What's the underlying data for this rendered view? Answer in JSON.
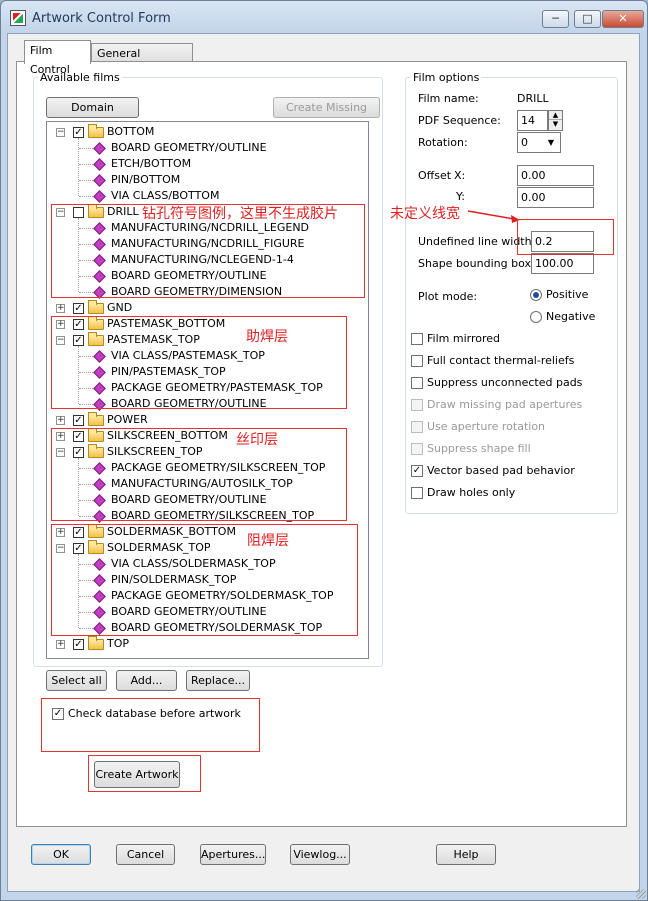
{
  "window": {
    "title": "Artwork Control Form",
    "controls": {
      "minimize": "─",
      "maximize": "□",
      "close": "✕"
    }
  },
  "tabs": [
    {
      "label": "Film Control",
      "active": true
    },
    {
      "label": "General Parameters",
      "active": false
    }
  ],
  "available_films": {
    "group_label": "Available films",
    "domain_selection": "Domain Selection",
    "create_missing_films": "Create Missing Films",
    "tree": [
      {
        "name": "BOTTOM",
        "checked": true,
        "expanded": true,
        "children": [
          "BOARD GEOMETRY/OUTLINE",
          "ETCH/BOTTOM",
          "PIN/BOTTOM",
          "VIA CLASS/BOTTOM"
        ]
      },
      {
        "name": "DRILL",
        "checked": false,
        "expanded": true,
        "children": [
          "MANUFACTURING/NCDRILL_LEGEND",
          "MANUFACTURING/NCDRILL_FIGURE",
          "MANUFACTURING/NCLEGEND-1-4",
          "BOARD GEOMETRY/OUTLINE",
          "BOARD GEOMETRY/DIMENSION"
        ]
      },
      {
        "name": "GND",
        "checked": true,
        "expanded": false,
        "children": []
      },
      {
        "name": "PASTEMASK_BOTTOM",
        "checked": true,
        "expanded": false,
        "children": []
      },
      {
        "name": "PASTEMASK_TOP",
        "checked": true,
        "expanded": true,
        "children": [
          "VIA CLASS/PASTEMASK_TOP",
          "PIN/PASTEMASK_TOP",
          "PACKAGE GEOMETRY/PASTEMASK_TOP",
          "BOARD GEOMETRY/OUTLINE"
        ]
      },
      {
        "name": "POWER",
        "checked": true,
        "expanded": false,
        "children": []
      },
      {
        "name": "SILKSCREEN_BOTTOM",
        "checked": true,
        "expanded": false,
        "children": []
      },
      {
        "name": "SILKSCREEN_TOP",
        "checked": true,
        "expanded": true,
        "children": [
          "PACKAGE GEOMETRY/SILKSCREEN_TOP",
          "MANUFACTURING/AUTOSILK_TOP",
          "BOARD GEOMETRY/OUTLINE",
          "BOARD GEOMETRY/SILKSCREEN_TOP"
        ]
      },
      {
        "name": "SOLDERMASK_BOTTOM",
        "checked": true,
        "expanded": false,
        "children": []
      },
      {
        "name": "SOLDERMASK_TOP",
        "checked": true,
        "expanded": true,
        "children": [
          "VIA CLASS/SOLDERMASK_TOP",
          "PIN/SOLDERMASK_TOP",
          "PACKAGE GEOMETRY/SOLDERMASK_TOP",
          "BOARD GEOMETRY/OUTLINE",
          "BOARD GEOMETRY/SOLDERMASK_TOP"
        ]
      },
      {
        "name": "TOP",
        "checked": true,
        "expanded": false,
        "children": []
      }
    ],
    "select_all": "Select all",
    "add": "Add...",
    "replace": "Replace...",
    "check_database": {
      "label": "Check database before artwork",
      "checked": true
    },
    "create_artwork": "Create Artwork"
  },
  "annotations": {
    "drill_note": "钻孔符号图例，这里不生成胶片",
    "line_width_note": "未定义线宽",
    "pastemask_note": "助焊层",
    "silkscreen_note": "丝印层",
    "soldermask_note": "阻焊层",
    "color": "#e02020"
  },
  "film_options": {
    "group_label": "Film options",
    "film_name_label": "Film name:",
    "film_name_value": "DRILL",
    "pdf_sequence_label": "PDF Sequence:",
    "pdf_sequence_value": "14",
    "rotation_label": "Rotation:",
    "rotation_value": "0",
    "offset_label": "Offset",
    "offset_x_label": "X:",
    "offset_x_value": "0.00",
    "offset_y_label": "Y:",
    "offset_y_value": "0.00",
    "undefined_line_width_label": "Undefined line width:",
    "undefined_line_width_value": "0.2",
    "shape_bounding_box_label": "Shape bounding box:",
    "shape_bounding_box_value": "100.00",
    "plot_mode_label": "Plot mode:",
    "plot_mode_positive": "Positive",
    "plot_mode_negative": "Negative",
    "plot_mode_selected": "Positive",
    "checkboxes": [
      {
        "label": "Film mirrored",
        "checked": false,
        "enabled": true
      },
      {
        "label": "Full contact thermal-reliefs",
        "checked": false,
        "enabled": true
      },
      {
        "label": "Suppress unconnected pads",
        "checked": false,
        "enabled": true
      },
      {
        "label": "Draw missing pad apertures",
        "checked": false,
        "enabled": false
      },
      {
        "label": "Use aperture rotation",
        "checked": false,
        "enabled": false
      },
      {
        "label": "Suppress shape fill",
        "checked": false,
        "enabled": false
      },
      {
        "label": "Vector based pad behavior",
        "checked": true,
        "enabled": true
      },
      {
        "label": "Draw holes only",
        "checked": false,
        "enabled": true
      }
    ]
  },
  "footer": {
    "ok": "OK",
    "cancel": "Cancel",
    "apertures": "Apertures...",
    "viewlog": "Viewlog...",
    "help": "Help"
  }
}
